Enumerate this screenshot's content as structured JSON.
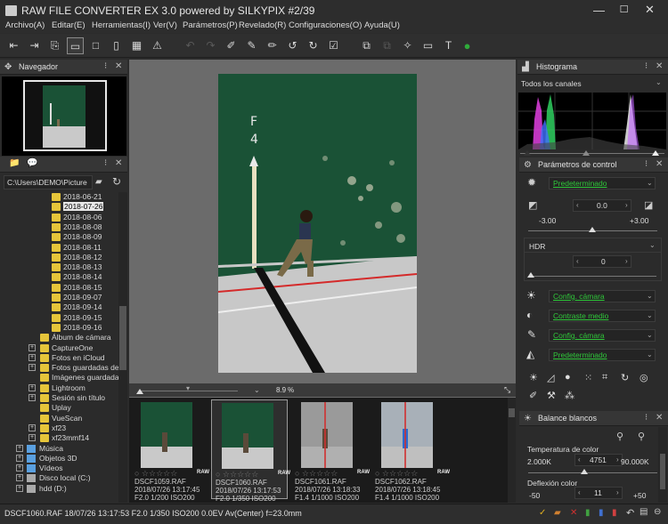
{
  "window": {
    "title": "RAW FILE CONVERTER EX 3.0 powered by SILKYPIX   #2/39"
  },
  "menu": [
    "Archivo(A)",
    "Editar(E)",
    "Herramientas(I)",
    "Ver(V)",
    "Parámetros(P)",
    "Revelado(R)",
    "Configuraciones(O)",
    "Ayuda(U)"
  ],
  "navigator": {
    "title": "Navegador"
  },
  "browser": {
    "path": "C:\\Users\\DEMO\\Picture",
    "dates": [
      "2018-06-21",
      "2018-07-26",
      "2018-08-06",
      "2018-08-08",
      "2018-08-09",
      "2018-08-11",
      "2018-08-12",
      "2018-08-13",
      "2018-08-14",
      "2018-08-15",
      "2018-09-07",
      "2018-09-14",
      "2018-09-15",
      "2018-09-16"
    ],
    "selected_date": "2018-07-26",
    "folders": [
      "Álbum de cámara",
      "CaptureOne",
      "Fotos en iCloud",
      "Fotos guardadas de",
      "Imágenes guardadas",
      "Lightroom",
      "Sesión sin título",
      "Uplay",
      "VueScan",
      "xf23",
      "xf23mmf14"
    ],
    "drives": [
      "Música",
      "Objetos 3D",
      "Vídeos",
      "Disco local (C:)",
      "hdd (D:)"
    ]
  },
  "viewer": {
    "zoom": "8.9",
    "zoom_unit": "%"
  },
  "filmstrip": [
    {
      "name": "DSCF1059.RAF",
      "date": "2018/07/26 13:17:45",
      "info": "F2.0 1/200 ISO200",
      "raw": "RAW",
      "selected": false
    },
    {
      "name": "DSCF1060.RAF",
      "date": "2018/07/26 13:17:53",
      "info": "F2.0 1/350 ISO200",
      "raw": "RAW",
      "selected": true
    },
    {
      "name": "DSCF1061.RAF",
      "date": "2018/07/26 13:18:33",
      "info": "F1.4 1/1000 ISO200",
      "raw": "RAW",
      "selected": false
    },
    {
      "name": "DSCF1062.RAF",
      "date": "2018/07/26 13:18:45",
      "info": "F1.4 1/1000 ISO200",
      "raw": "RAW",
      "selected": false
    }
  ],
  "histogram": {
    "title": "Histograma",
    "channel": "Todos los canales"
  },
  "params": {
    "title": "Parámetros de control",
    "preset": "Predeterminado",
    "exposure": {
      "value": "0.0",
      "min": "-3.00",
      "max": "+3.00"
    },
    "hdr": {
      "label": "HDR",
      "value": "0"
    },
    "rows": [
      "Config. cámara",
      "Contraste medio",
      "Config. cámara",
      "Predeterminado"
    ]
  },
  "wb": {
    "title": "Balance blancos",
    "temp_label": "Temperatura de color",
    "temp_min": "2.000K",
    "temp_value": "4751",
    "temp_max": "90.000K",
    "tint_label": "Deflexión color",
    "tint_min": "-50",
    "tint_value": "11",
    "tint_max": "+50"
  },
  "status": "DSCF1060.RAF 18/07/26 13:17:53 F2.0 1/350 ISO200  0.0EV Av(Center) f=23.0mm",
  "colors": {
    "accent_green": "#2fc83a",
    "folder": "#e6c53a",
    "wall": "#1a5236"
  }
}
